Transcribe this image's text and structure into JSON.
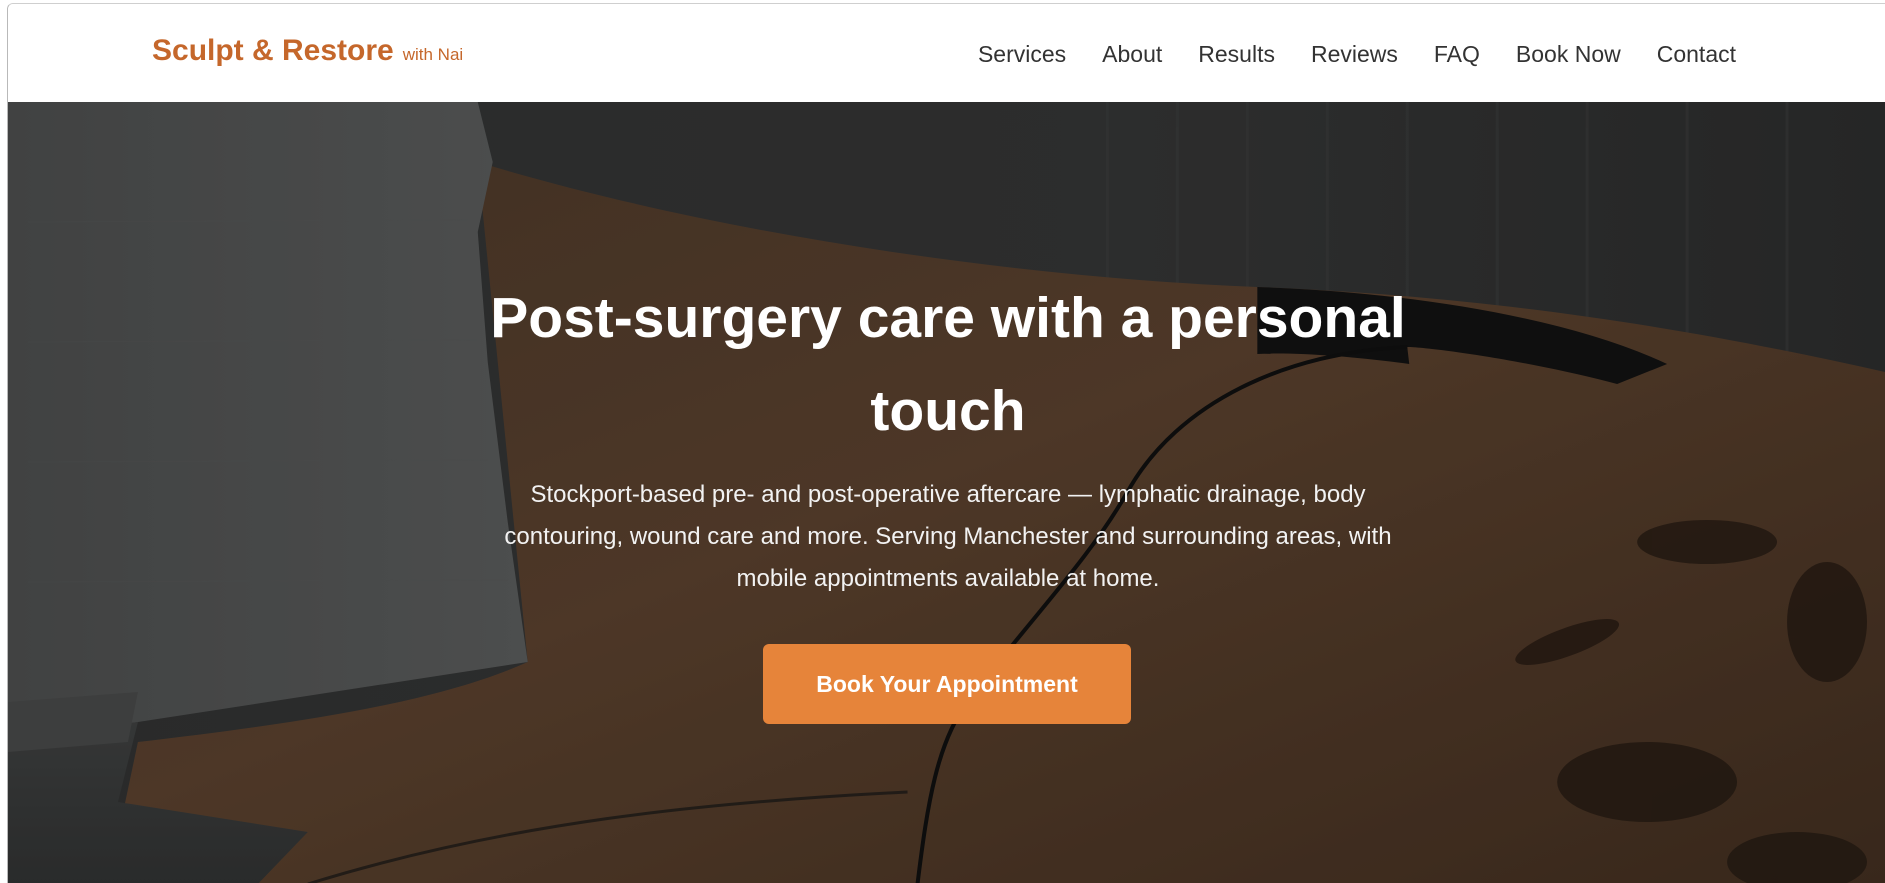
{
  "header": {
    "brand_name": "Sculpt & Restore",
    "brand_sub": "with Nai",
    "brand_color": "#c5672b",
    "nav": [
      {
        "label": "Services"
      },
      {
        "label": "About"
      },
      {
        "label": "Results"
      },
      {
        "label": "Reviews"
      },
      {
        "label": "FAQ"
      },
      {
        "label": "Book Now"
      },
      {
        "label": "Contact"
      }
    ]
  },
  "hero": {
    "title": "Post-surgery care with a personal touch",
    "description": "Stockport-based pre- and post-operative aftercare — lymphatic drainage, body contouring, wound care and more. Serving Manchester and surrounding areas, with mobile appointments available at home.",
    "cta_label": "Book Your Appointment",
    "cta_color": "#e6843a"
  }
}
